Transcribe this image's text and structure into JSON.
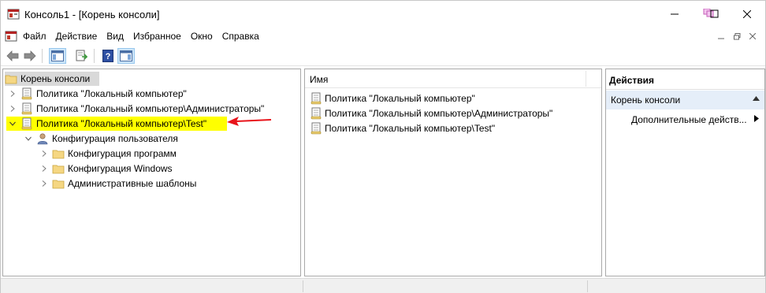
{
  "window": {
    "title": "Консоль1 - [Корень консоли]"
  },
  "menu": {
    "items": [
      "Файл",
      "Действие",
      "Вид",
      "Избранное",
      "Окно",
      "Справка"
    ]
  },
  "toolbar": {
    "tools": [
      "back-icon",
      "forward-icon",
      "show-hide-tree-icon",
      "export-list-icon",
      "help-icon",
      "show-hide-action-pane-icon"
    ]
  },
  "tree": {
    "root": "Корень консоли",
    "items": [
      {
        "label": "Политика \"Локальный компьютер\""
      },
      {
        "label": "Политика \"Локальный компьютер\\Администраторы\""
      },
      {
        "label": "Политика \"Локальный компьютер\\Test\""
      },
      {
        "label": "Конфигурация пользователя"
      },
      {
        "label": "Конфигурация программ"
      },
      {
        "label": "Конфигурация Windows"
      },
      {
        "label": "Административные шаблоны"
      }
    ]
  },
  "list": {
    "column": "Имя",
    "rows": [
      {
        "label": "Политика \"Локальный компьютер\""
      },
      {
        "label": "Политика \"Локальный компьютер\\Администраторы\""
      },
      {
        "label": "Политика \"Локальный компьютер\\Test\""
      }
    ]
  },
  "actions": {
    "header": "Действия",
    "section": "Корень консоли",
    "item": "Дополнительные действ..."
  },
  "colors": {
    "highlight": "#ffff00",
    "annotation_arrow": "#e8141b",
    "actions_section_bg": "#e5eef9"
  }
}
